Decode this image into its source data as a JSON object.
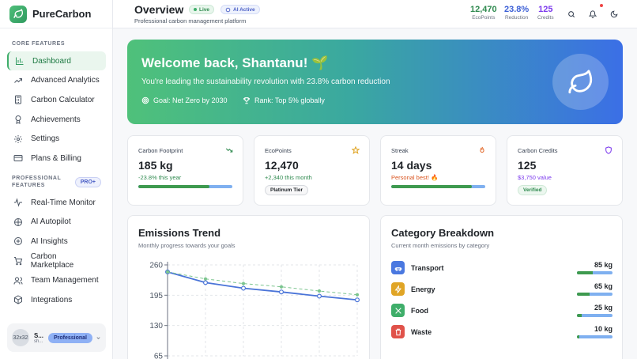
{
  "app": {
    "name": "PureCarbon"
  },
  "sidebar": {
    "core_heading": "CORE FEATURES",
    "core_items": [
      {
        "label": "Dashboard",
        "icon": "bar-chart-icon",
        "active": true
      },
      {
        "label": "Advanced Analytics",
        "icon": "trending-up-icon"
      },
      {
        "label": "Carbon Calculator",
        "icon": "calculator-icon"
      },
      {
        "label": "Achievements",
        "icon": "award-icon"
      },
      {
        "label": "Settings",
        "icon": "gear-icon"
      },
      {
        "label": "Plans & Billing",
        "icon": "credit-card-icon"
      }
    ],
    "pro_heading": "PROFESSIONAL FEATURES",
    "pro_badge": "PRO+",
    "pro_items": [
      {
        "label": "Real-Time Monitor",
        "icon": "activity-icon"
      },
      {
        "label": "AI Autopilot",
        "icon": "bot-icon"
      },
      {
        "label": "AI Insights",
        "icon": "sparkle-icon"
      },
      {
        "label": "Carbon Marketplace",
        "icon": "cart-icon"
      },
      {
        "label": "Team Management",
        "icon": "users-icon"
      },
      {
        "label": "Integrations",
        "icon": "package-icon"
      }
    ],
    "user": {
      "avatar_text": "32x32",
      "name": "S...",
      "sub": "sh...",
      "plan": "Professional"
    }
  },
  "header": {
    "title": "Overview",
    "subtitle": "Professional carbon management platform",
    "badge_live": "Live",
    "badge_ai": "AI Active",
    "stats": [
      {
        "value": "12,470",
        "label": "EcoPoints",
        "color": "#2f8a4f"
      },
      {
        "value": "23.8%",
        "label": "Reduction",
        "color": "#3b5fd6"
      },
      {
        "value": "125",
        "label": "Credits",
        "color": "#7c3aed"
      }
    ]
  },
  "hero": {
    "title": "Welcome back, Shantanu! 🌱",
    "subtitle": "You're leading the sustainability revolution with 23.8% carbon reduction",
    "goal": "Goal: Net Zero by 2030",
    "rank": "Rank: Top 5% globally"
  },
  "stats": [
    {
      "label": "Carbon Footprint",
      "value": "185 kg",
      "sub": "-23.8% this year",
      "sub_color": "#2f8a4f",
      "progress": 0.76,
      "icon": "trending-down-icon",
      "icon_color": "#2f8a4f"
    },
    {
      "label": "EcoPoints",
      "value": "12,470",
      "sub": "+2,340 this month",
      "sub_color": "#2f8a4f",
      "tag": "Platinum Tier",
      "icon": "star-icon",
      "icon_color": "#e0a526"
    },
    {
      "label": "Streak",
      "value": "14 days",
      "sub": "Personal best! 🔥",
      "sub_color": "#d9541f",
      "progress": 0.86,
      "icon": "flame-icon",
      "icon_color": "#e36a2c"
    },
    {
      "label": "Carbon Credits",
      "value": "125",
      "sub": "$3,750 value",
      "sub_color": "#7c3aed",
      "tag": "Verified",
      "icon": "shield-icon",
      "icon_color": "#7c3aed"
    }
  ],
  "trend": {
    "title": "Emissions Trend",
    "subtitle": "Monthly progress towards your goals"
  },
  "chart_data": {
    "type": "line",
    "title": "Emissions Trend",
    "y_ticks": [
      260,
      195,
      130,
      65
    ],
    "ylim": [
      65,
      260
    ],
    "series": [
      {
        "values": [
          245,
          222,
          210,
          202,
          193,
          185
        ],
        "color": "#4a74d8",
        "style": "solid"
      },
      {
        "values": [
          245,
          230,
          220,
          213,
          204,
          196
        ],
        "color": "#7cc58f",
        "style": "dashed"
      }
    ],
    "grid": true
  },
  "breakdown": {
    "title": "Category Breakdown",
    "subtitle": "Current month emissions by category",
    "items": [
      {
        "name": "Transport",
        "value": "85 kg",
        "share": 0.45,
        "icon": "car-icon",
        "color": "#4a78e0"
      },
      {
        "name": "Energy",
        "value": "65 kg",
        "share": 0.35,
        "icon": "bolt-icon",
        "color": "#e0a526"
      },
      {
        "name": "Food",
        "value": "25 kg",
        "share": 0.14,
        "icon": "utensils-icon",
        "color": "#3fae6a"
      },
      {
        "name": "Waste",
        "value": "10 kg",
        "share": 0.06,
        "icon": "trash-icon",
        "color": "#e0524a"
      }
    ]
  }
}
